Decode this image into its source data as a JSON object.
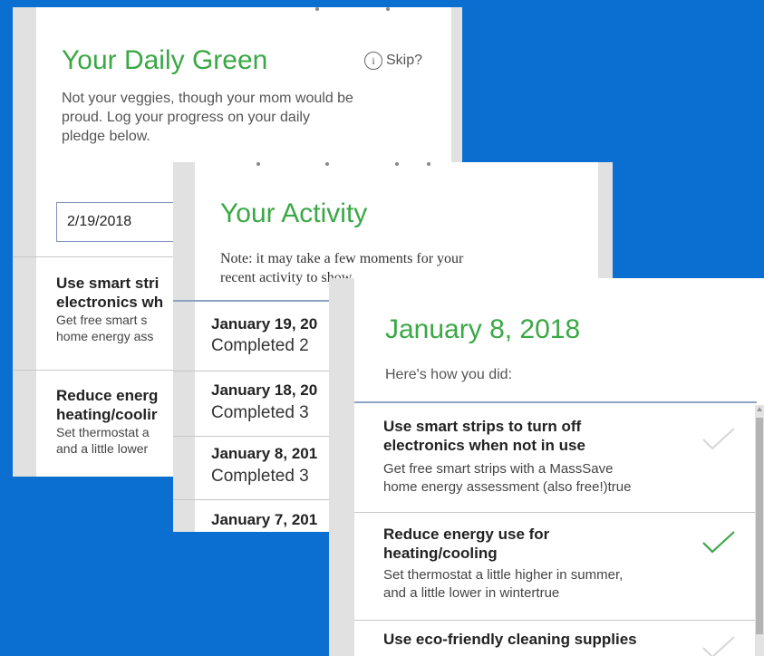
{
  "pledge_card": {
    "title": "Your Daily Green",
    "info_icon": "info-circle-icon",
    "skip_label": "Skip?",
    "intro_line1": "Not your veggies, though your mom would be",
    "intro_line2": "proud. Log your progress on your daily",
    "intro_line3": "pledge below.",
    "date_value": "2/19/2018",
    "items": [
      {
        "title_line1": "Use smart stri",
        "title_line2": "electronics wh",
        "desc_line1": "Get free smart s",
        "desc_line2": "home energy ass"
      },
      {
        "title_line1": "Reduce energ",
        "title_line2": "heating/coolir",
        "desc_line1": "Set thermostat a",
        "desc_line2": "and a little lower"
      }
    ]
  },
  "activity_card": {
    "title": "Your Activity",
    "note_line1": "Note: it may take a few moments for your",
    "note_line2": "recent activity to show.",
    "entries": [
      {
        "date": "January 19, 20",
        "status": "Completed 2"
      },
      {
        "date": "January 18, 20",
        "status": "Completed 3"
      },
      {
        "date": "January 8, 201",
        "status": "Completed 3"
      },
      {
        "date": "January 7, 201",
        "status": ""
      }
    ]
  },
  "detail_card": {
    "title": "January 8, 2018",
    "subtitle": "Here's how you did:",
    "items": [
      {
        "title_line1": "Use smart strips to turn off",
        "title_line2": "electronics when not in use",
        "desc_line1": "Get free smart strips with a MassSave",
        "desc_line2": "home energy assessment (also free!)true",
        "check_color": "#d6d6d6"
      },
      {
        "title_line1": "Reduce energy use for",
        "title_line2": "heating/cooling",
        "desc_line1": "Set thermostat a little higher in summer,",
        "desc_line2": "and a little lower in wintertrue",
        "check_color": "#3aa845"
      },
      {
        "title_line1": "Use eco-friendly cleaning supplies",
        "title_line2": "",
        "desc_line1": "",
        "desc_line2": "",
        "check_color": "#d6d6d6"
      }
    ]
  },
  "colors": {
    "background": "#0a6fd0",
    "accent_green": "#3aa845",
    "divider_blue": "#8ea3c4"
  }
}
